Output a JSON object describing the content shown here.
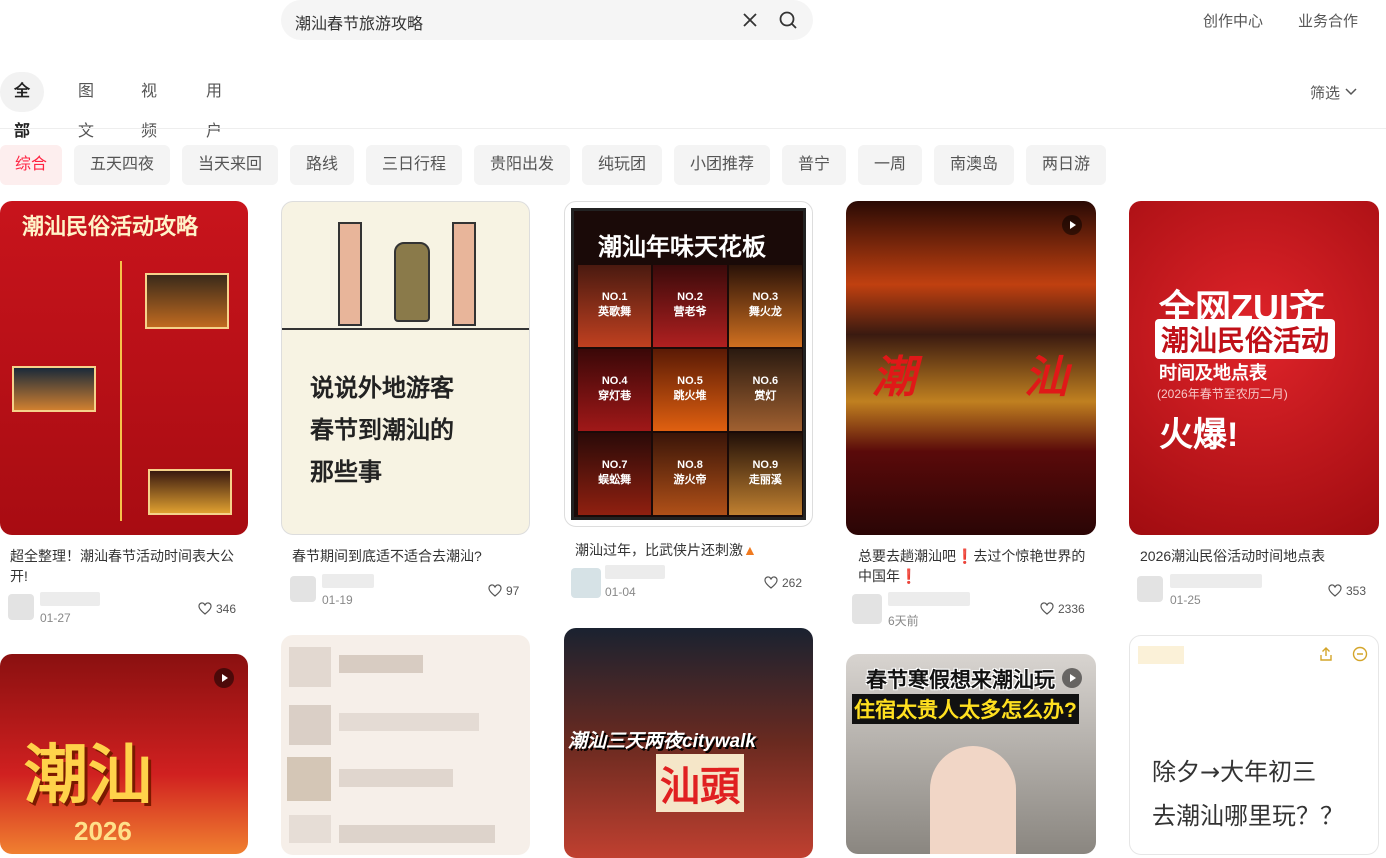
{
  "search": {
    "query": "潮汕春节旅游攻略"
  },
  "toplinks": {
    "creator": "创作中心",
    "business": "业务合作"
  },
  "tabs": [
    "全部",
    "图文",
    "视频",
    "用户"
  ],
  "filter_label": "筛选",
  "chips": [
    "综合",
    "五天四夜",
    "当天来回",
    "路线",
    "三日行程",
    "贵阳出发",
    "纯玩团",
    "小团推荐",
    "普宁",
    "一周",
    "南澳岛",
    "两日游"
  ],
  "cards": [
    {
      "title": "超全整理！潮汕春节活动时间表大公开!",
      "date": "01-27",
      "likes": "346",
      "poster": "潮汕民俗活动攻略"
    },
    {
      "title": "春节期间到底适不适合去潮汕?",
      "date": "01-19",
      "likes": "97",
      "poster_lines": [
        "说说外地游客",
        "春节到潮汕的",
        "那些事"
      ]
    },
    {
      "title": "潮汕过年，比武侠片还刺激",
      "date": "01-04",
      "likes": "262",
      "poster": "潮汕年味天花板",
      "grid": [
        "NO.1\n英歌舞",
        "NO.2\n营老爷",
        "NO.3\n舞火龙",
        "NO.4\n穿灯巷",
        "NO.5\n跳火堆",
        "NO.6\n赏灯",
        "NO.7\n蜈蚣舞",
        "NO.8\n游火帝",
        "NO.9\n走丽溪"
      ]
    },
    {
      "title": "总要去趟潮汕吧❗去过个惊艳世界的中国年❗",
      "date": "6天前",
      "likes": "2336",
      "poster_chars": [
        "潮",
        "汕"
      ]
    },
    {
      "title": "2026潮汕民俗活动时间地点表",
      "date": "01-25",
      "likes": "353",
      "poster_lines": [
        "全网ZUI齐",
        "潮汕民俗活动",
        "时间及地点表",
        "(2026年春节至农历二月)",
        "火爆!"
      ]
    }
  ],
  "row2": [
    {
      "poster": "潮汕",
      "sub": "2026"
    },
    {
      "poster": ""
    },
    {
      "poster": "潮汕三天两夜citywalk",
      "sub": "汕頭"
    },
    {
      "poster_lines": [
        "春节寒假想来潮汕玩",
        "住宿太贵人太多怎么办?"
      ]
    },
    {
      "poster_lines": [
        "除夕→大年初三",
        "去潮汕哪里玩？？"
      ]
    }
  ],
  "colors": {
    "accent": "#ff2442",
    "chip_bg": "#f4f4f4"
  }
}
